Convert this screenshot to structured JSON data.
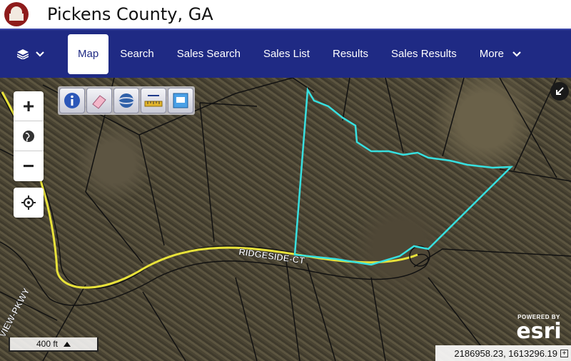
{
  "header": {
    "title": "Pickens County, GA",
    "logo": "county-courthouse-seal"
  },
  "nav": {
    "layers_icon": "layers-icon",
    "items": [
      {
        "label": "Map"
      },
      {
        "label": "Search"
      },
      {
        "label": "Sales Search"
      },
      {
        "label": "Sales List"
      },
      {
        "label": "Results"
      },
      {
        "label": "Sales Results"
      },
      {
        "label": "More"
      }
    ],
    "active": "Map"
  },
  "map": {
    "street_labels": [
      "RIDGESIDE-CT",
      "VIEW-PKWY"
    ],
    "highlight_color": "#37e0e0",
    "road_color": "#e8e23a",
    "scale_label": "400 ft",
    "coordinates": "2186958.23, 1613296.19",
    "attribution_powered": "POWERED BY",
    "attribution_brand": "esri"
  },
  "toolbar": {
    "tools": [
      "info-icon",
      "eraser-icon",
      "globe-icon",
      "measure-icon",
      "print-icon"
    ]
  },
  "zoom": {
    "in": "+",
    "out": "−"
  }
}
